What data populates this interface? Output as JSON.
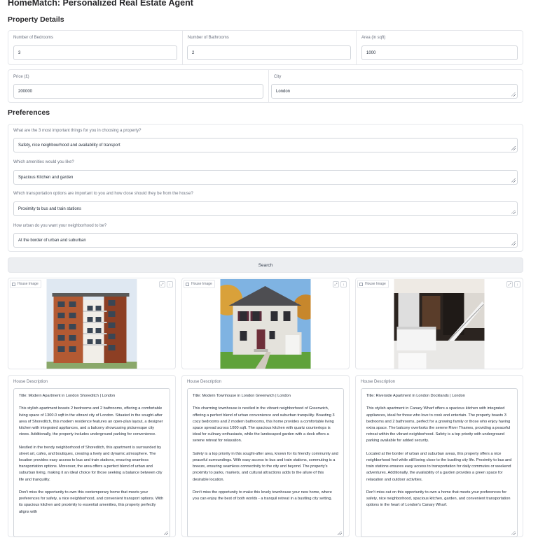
{
  "app": {
    "title": "HomeMatch: Personalized Real Estate Agent"
  },
  "property_details": {
    "title": "Property Details",
    "bedrooms": {
      "label": "Number of Bedrooms",
      "value": "3"
    },
    "bathrooms": {
      "label": "Number of Bathrooms",
      "value": "2"
    },
    "area": {
      "label": "Area (in sqft)",
      "value": "1000"
    },
    "price": {
      "label": "Price (£)",
      "value": "200000"
    },
    "city": {
      "label": "City",
      "value": "London"
    }
  },
  "preferences": {
    "title": "Preferences",
    "questions": [
      {
        "label": "What are the 3 most important things for you in choosing a property?",
        "value": "Safety, nice neighbourhood and availability of transport"
      },
      {
        "label": "Which amenities would you like?",
        "value": "Spacious Kitchen and garden"
      },
      {
        "label": "Which transportation options are important to you and how close should they be from the house?",
        "value": "Proximity to bus and train stations"
      },
      {
        "label": "How urban do you want your neighborhood to be?",
        "value": "At the border of urban and suburban"
      }
    ]
  },
  "search": {
    "label": "Search"
  },
  "results": [
    {
      "image_label": "House Image",
      "desc_label": "House Description",
      "description": "Title: Modern Apartment in London Shoreditch | London\n\nThis stylish apartment boasts 2 bedrooms and 2 bathrooms, offering a comfortable living space of 1300.0 sqft in the vibrant city of London. Situated in the sought-after area of Shoreditch, this modern residence features an open-plan layout, a designer kitchen with integrated appliances, and a balcony showcasing picturesque city views. Additionally, the property includes underground parking for convenience.\n\nNestled in the trendy neighborhood of Shoreditch, this apartment is surrounded by street art, cafes, and boutiques, creating a lively and dynamic atmosphere. The location provides easy access to bus and train stations, ensuring seamless transportation options. Moreover, the area offers a perfect blend of urban and suburban living, making it an ideal choice for those seeking a balance between city life and tranquility.\n\nDon't miss the opportunity to own this contemporary home that meets your preferences for safety, a nice neighborhood, and convenient transport options. With its spacious kitchen and proximity to essential amenities, this property perfectly aligns with"
    },
    {
      "image_label": "House Image",
      "desc_label": "House Description",
      "description": "Title: Modern Townhouse in London Greenwich | London\n\nThis charming townhouse is nestled in the vibrant neighborhood of Greenwich, offering a perfect blend of urban convenience and suburban tranquility. Boasting 3 cozy bedrooms and 2 modern bathrooms, this home provides a comfortable living space spread across 1000 sqft. The spacious kitchen with quartz countertops is ideal for culinary enthusiasts, while the landscaped garden with a deck offers a serene retreat for relaxation.\n\nSafety is a top priority in this sought-after area, known for its friendly community and peaceful surroundings. With easy access to bus and train stations, commuting is a breeze, ensuring seamless connectivity to the city and beyond. The property's proximity to parks, markets, and cultural attractions adds to the allure of this desirable location.\n\nDon't miss the opportunity to make this lovely townhouse your new home, where you can enjoy the best of both worlds - a tranquil retreat in a bustling city setting."
    },
    {
      "image_label": "House Image",
      "desc_label": "House Description",
      "description": "Title: Riverside Apartment in London Docklands | London\n\nThis stylish apartment in Canary Wharf offers a spacious kitchen with integrated appliances, ideal for those who love to cook and entertain. The property boasts 3 bedrooms and 2 bathrooms, perfect for a growing family or those who enjoy having extra space. The balcony overlooks the serene River Thames, providing a peaceful retreat within the vibrant neighborhood. Safety is a top priority with underground parking available for added security.\n\nLocated at the border of urban and suburban areas, this property offers a nice neighborhood feel while still being close to the bustling city life. Proximity to bus and train stations ensures easy access to transportation for daily commutes or weekend adventures. Additionally, the availability of a garden provides a green space for relaxation and outdoor activities.\n\nDon't miss out on this opportunity to own a home that meets your preferences for safety, nice neighborhood, spacious kitchen, garden, and convenient transportation options in the heart of London's Canary Wharf."
    }
  ],
  "icons": {
    "image": "image-icon",
    "fullscreen": "fullscreen-icon",
    "download": "download-icon",
    "resize": "resize-grip-icon"
  }
}
